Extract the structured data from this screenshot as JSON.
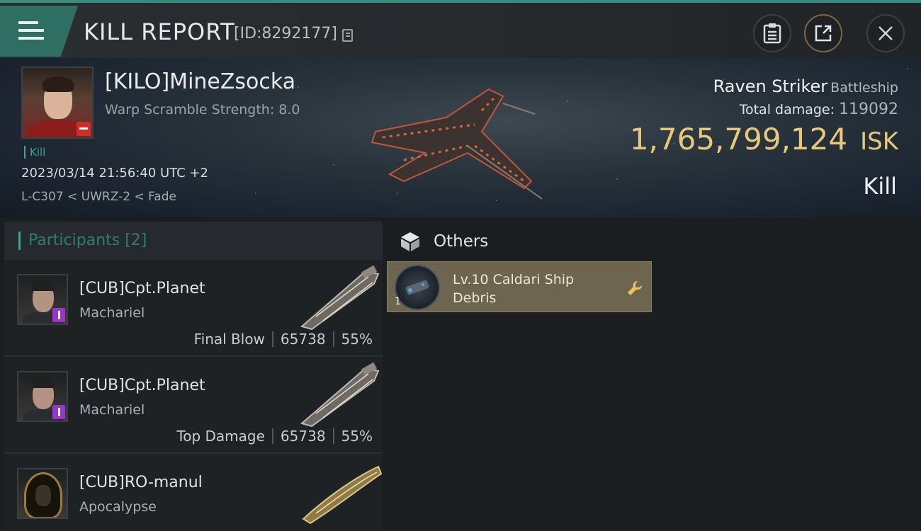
{
  "header": {
    "title": "KILL REPORT",
    "report_id": "[ID:8292177]"
  },
  "victim": {
    "name": "[KILO]MineZsocka",
    "warp_scramble": "Warp Scramble Strength: 8.0",
    "kill_tag": "Kill",
    "datetime": "2023/03/14 21:56:40 UTC +2",
    "location": "L-C307 < UWRZ-2 < Fade",
    "ship_name": "Raven Striker",
    "ship_class": "Battleship",
    "total_damage_label": "Total damage:",
    "total_damage": "119092",
    "isk_value": "1,765,799,124",
    "isk_unit": "ISK",
    "result": "Kill"
  },
  "participants": {
    "title": "Participants [2]",
    "rows": [
      {
        "name": "[CUB]Cpt.Planet",
        "ship": "Machariel",
        "role": "Final Blow",
        "damage": "65738",
        "percent": "55%"
      },
      {
        "name": "[CUB]Cpt.Planet",
        "ship": "Machariel",
        "role": "Top Damage",
        "damage": "65738",
        "percent": "55%"
      },
      {
        "name": "[CUB]RO-manul",
        "ship": "Apocalypse"
      }
    ]
  },
  "others": {
    "title": "Others",
    "items": [
      {
        "quantity": "1",
        "name": "Lv.10 Caldari Ship Debris"
      }
    ]
  },
  "colors": {
    "accent_teal": "#3aa68f",
    "isk_gold": "#e8c97a",
    "item_card": "#6e6550"
  }
}
